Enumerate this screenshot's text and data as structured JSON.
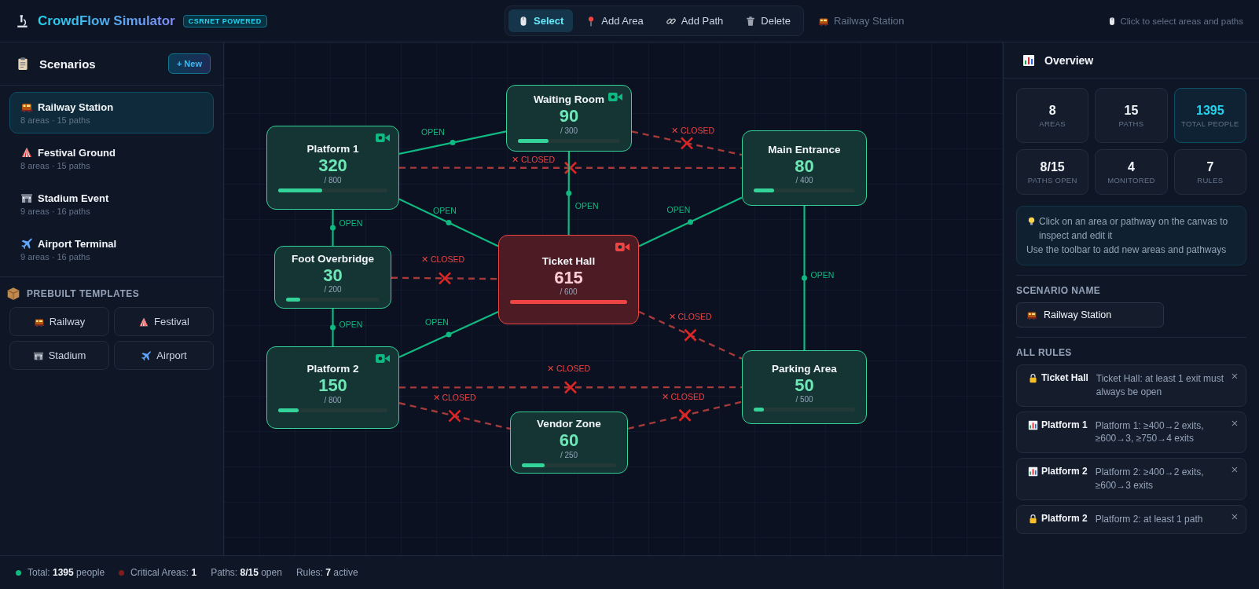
{
  "app": {
    "title": "CrowdFlow Simulator",
    "badge": "CSRNET POWERED"
  },
  "toolbar": [
    {
      "label": "Select",
      "selected": true
    },
    {
      "label": "Add Area",
      "selected": false
    },
    {
      "label": "Add Path",
      "selected": false
    },
    {
      "label": "Delete",
      "selected": false
    }
  ],
  "current_scenario": "Railway Station",
  "hint": "Click to select areas and paths",
  "sidebar": {
    "title": "Scenarios",
    "new_button": "+ New",
    "scenarios": [
      {
        "name": "Railway Station",
        "meta": "8 areas · 15 paths",
        "selected": true
      },
      {
        "name": "Festival Ground",
        "meta": "8 areas · 15 paths",
        "selected": false
      },
      {
        "name": "Stadium Event",
        "meta": "9 areas · 16 paths",
        "selected": false
      },
      {
        "name": "Airport Terminal",
        "meta": "9 areas · 16 paths",
        "selected": false
      }
    ],
    "templates_title": "PREBUILT TEMPLATES",
    "templates": [
      "Railway",
      "Festival",
      "Stadium",
      "Airport"
    ]
  },
  "canvas": {
    "areas": [
      {
        "name": "Platform 1",
        "count": "320",
        "capacity": "/ 800",
        "level": 0.4,
        "monitored": true,
        "critical": false
      },
      {
        "name": "Waiting Room",
        "count": "90",
        "capacity": "/ 300",
        "level": 0.3,
        "monitored": true,
        "critical": false
      },
      {
        "name": "Main Entrance",
        "count": "80",
        "capacity": "/ 400",
        "level": 0.2,
        "monitored": false,
        "critical": false
      },
      {
        "name": "Foot Overbridge",
        "count": "30",
        "capacity": "/ 200",
        "level": 0.15,
        "monitored": false,
        "critical": false
      },
      {
        "name": "Ticket Hall",
        "count": "615",
        "capacity": "/ 600",
        "level": 1,
        "monitored": true,
        "critical": true
      },
      {
        "name": "Platform 2",
        "count": "150",
        "capacity": "/ 800",
        "level": 0.19,
        "monitored": true,
        "critical": false
      },
      {
        "name": "Vendor Zone",
        "count": "60",
        "capacity": "/ 250",
        "level": 0.24,
        "monitored": false,
        "critical": false
      },
      {
        "name": "Parking Area",
        "count": "50",
        "capacity": "/ 500",
        "level": 0.1,
        "monitored": false,
        "critical": false
      }
    ],
    "paths": [
      {
        "open": true,
        "label": "OPEN"
      },
      {
        "open": false,
        "label": "✕ CLOSED"
      },
      {
        "open": false,
        "label": "✕ CLOSED"
      },
      {
        "open": true,
        "label": "OPEN"
      },
      {
        "open": true,
        "label": "OPEN"
      },
      {
        "open": true,
        "label": "OPEN"
      },
      {
        "open": true,
        "label": "OPEN"
      },
      {
        "open": false,
        "label": "✕ CLOSED"
      },
      {
        "open": true,
        "label": "OPEN"
      },
      {
        "open": true,
        "label": "OPEN"
      },
      {
        "open": true,
        "label": "OPEN"
      },
      {
        "open": false,
        "label": "✕ CLOSED"
      },
      {
        "open": false,
        "label": "✕ CLOSED"
      },
      {
        "open": false,
        "label": "✕ CLOSED"
      },
      {
        "open": false,
        "label": "✕ CLOSED"
      }
    ]
  },
  "overview": {
    "title": "Overview",
    "stats": [
      {
        "value": "8",
        "label": "AREAS",
        "highlight": false
      },
      {
        "value": "15",
        "label": "PATHS",
        "highlight": false
      },
      {
        "value": "1395",
        "label": "TOTAL PEOPLE",
        "highlight": true
      },
      {
        "value": "8/15",
        "label": "PATHS OPEN",
        "highlight": false
      },
      {
        "value": "4",
        "label": "MONITORED",
        "highlight": false
      },
      {
        "value": "7",
        "label": "RULES",
        "highlight": false
      }
    ],
    "info": [
      "Click on an area or pathway on the canvas to inspect and edit it",
      "Use the toolbar to add new areas and pathways"
    ],
    "scenario_name_label": "SCENARIO NAME",
    "scenario_name": "Railway Station",
    "rules_title": "ALL RULES",
    "rules": [
      {
        "kind": "lock",
        "area": "Ticket Hall",
        "text": "Ticket Hall: at least 1 exit must always be open"
      },
      {
        "kind": "threshold",
        "area": "Platform 1",
        "text": "Platform 1: ≥400→2 exits, ≥600→3, ≥750→4 exits"
      },
      {
        "kind": "threshold",
        "area": "Platform 2",
        "text": "Platform 2: ≥400→2 exits, ≥600→3 exits"
      },
      {
        "kind": "lock",
        "area": "Platform 2",
        "text": "Platform 2: at least 1 path"
      }
    ]
  },
  "status_bar": [
    {
      "text": "Total: **1395** people",
      "color": "#10b981"
    },
    {
      "text": "Critical Areas: **1**",
      "color": "#7f1d1d"
    },
    {
      "text": "Paths: **8/15** open"
    },
    {
      "text": "Rules: **7** active"
    }
  ]
}
